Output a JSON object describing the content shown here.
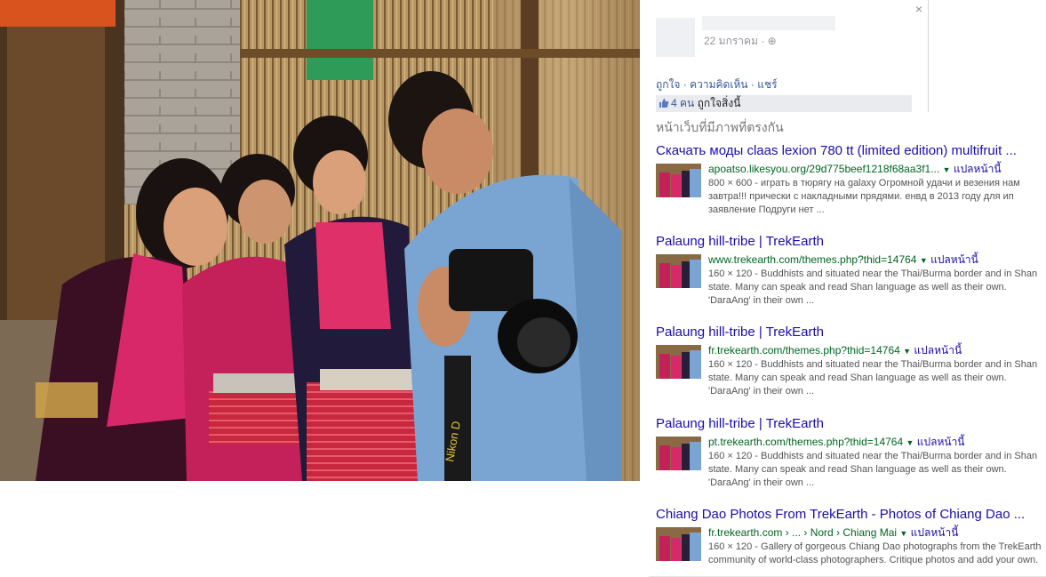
{
  "photo": {
    "camera_strap_text": "Nikon D"
  },
  "facebook_post": {
    "date": "22 มกราคม ·",
    "close_glyph": "×",
    "privacy_glyph": "⊕",
    "actions": [
      "ถูกใจ",
      "ความคิดเห็น",
      "แชร์"
    ],
    "separator": "·",
    "likes_count": "4 คน",
    "likes_text": "ถูกใจสิ่งนี้"
  },
  "matching_pages": {
    "heading": "หน้าเว็บที่มีภาพที่ตรงกัน",
    "translate_label": "แปลหน้านี้",
    "results": [
      {
        "title": "Скачать моды claas lexion 780 tt (limited edition) multifruit ...",
        "url": "apoatso.likesyou.org/29d775beef1218f68aa3f1...",
        "desc": "800 × 600 - играть в тюрягу на galaxy Огромной удачи и везения нам завтра!!! прически с накладными прядями. енвд в 2013 году для ип заявление Подруги нет ..."
      },
      {
        "title": "Palaung hill-tribe | TrekEarth",
        "url": "www.trekearth.com/themes.php?thid=14764",
        "desc": "160 × 120 - Buddhists and situated near the Thai/Burma border and in Shan state. Many can speak and read Shan language as well as their own. 'DaraAng' in their own ..."
      },
      {
        "title": "Palaung hill-tribe | TrekEarth",
        "url": "fr.trekearth.com/themes.php?thid=14764",
        "desc": "160 × 120 - Buddhists and situated near the Thai/Burma border and in Shan state. Many can speak and read Shan language as well as their own. 'DaraAng' in their own ..."
      },
      {
        "title": "Palaung hill-tribe | TrekEarth",
        "url": "pt.trekearth.com/themes.php?thid=14764",
        "desc": "160 × 120 - Buddhists and situated near the Thai/Burma border and in Shan state. Many can speak and read Shan language as well as their own. 'DaraAng' in their own ..."
      },
      {
        "title": "Chiang Dao Photos From TrekEarth - Photos of Chiang Dao ...",
        "url": "fr.trekearth.com › ... › Nord › Chiang Mai",
        "desc": "160 × 120 - Gallery of gorgeous Chiang Dao photographs from the TrekEarth community of world-class photographers. Critique photos and add your own."
      }
    ]
  },
  "colors": {
    "link_blue": "#1a0dab",
    "url_green": "#006621",
    "fb_blue": "#365899",
    "snippet_gray": "#545454"
  }
}
